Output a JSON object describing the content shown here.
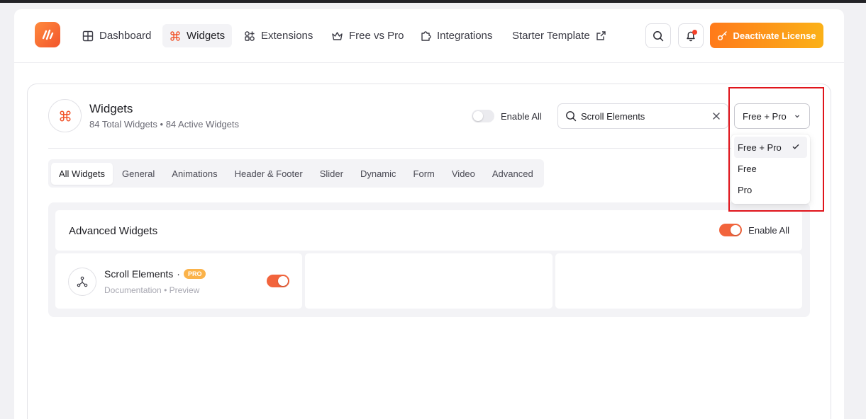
{
  "nav": {
    "items": [
      {
        "label": "Dashboard",
        "icon": "grid-icon"
      },
      {
        "label": "Widgets",
        "icon": "command-icon"
      },
      {
        "label": "Extensions",
        "icon": "extensions-icon"
      },
      {
        "label": "Free vs Pro",
        "icon": "crown-icon"
      },
      {
        "label": "Integrations",
        "icon": "puzzle-icon"
      },
      {
        "label": "Starter Template",
        "icon": "external-link-icon"
      }
    ],
    "cta_label": "Deactivate License"
  },
  "header": {
    "title": "Widgets",
    "total": "84 Total Widgets",
    "separator": "•",
    "active": "84 Active Widgets",
    "enable_all_label": "Enable All",
    "enable_all_on": false
  },
  "search": {
    "value": "Scroll Elements"
  },
  "filter": {
    "selected": "Free + Pro",
    "options": [
      "Free + Pro",
      "Free",
      "Pro"
    ]
  },
  "tabs": [
    "All Widgets",
    "General",
    "Animations",
    "Header & Footer",
    "Slider",
    "Dynamic",
    "Form",
    "Video",
    "Advanced"
  ],
  "section": {
    "title": "Advanced Widgets",
    "enable_all_label": "Enable All",
    "enable_all_on": true
  },
  "widgets": [
    {
      "name": "Scroll Elements",
      "separator": "·",
      "badge": "PRO",
      "doc_label": "Documentation",
      "dot": "•",
      "preview_label": "Preview",
      "enabled": true
    }
  ],
  "colors": {
    "accent": "#f2643c",
    "cta_start": "#ff7a1a",
    "cta_end": "#fbb118",
    "highlight": "#e0141b"
  }
}
